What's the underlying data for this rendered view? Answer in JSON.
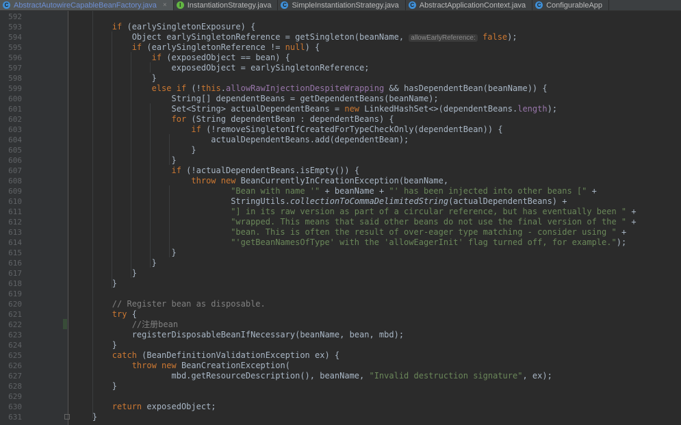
{
  "tabs": [
    {
      "label": "AbstractAutowireCapableBeanFactory.java",
      "icon": "C",
      "active": true,
      "close": "×"
    },
    {
      "label": "InstantiationStrategy.java",
      "icon": "I",
      "active": false
    },
    {
      "label": "SimpleInstantiationStrategy.java",
      "icon": "C",
      "active": false
    },
    {
      "label": "AbstractApplicationContext.java",
      "icon": "C",
      "active": false
    },
    {
      "label": "ConfigurableApp",
      "icon": "C",
      "active": false
    }
  ],
  "editor": {
    "lines": [
      {
        "n": "592",
        "segs": []
      },
      {
        "n": "593",
        "segs": [
          {
            "t": "        "
          },
          {
            "t": "if",
            "c": "kw"
          },
          {
            "t": " (earlySingletonExposure) {"
          }
        ]
      },
      {
        "n": "594",
        "segs": [
          {
            "t": "            Object earlySingletonReference = getSingleton(beanName, "
          },
          {
            "t": "allowEarlyReference:",
            "c": "hint"
          },
          {
            "t": " "
          },
          {
            "t": "false",
            "c": "kw"
          },
          {
            "t": ");"
          }
        ]
      },
      {
        "n": "595",
        "segs": [
          {
            "t": "            "
          },
          {
            "t": "if",
            "c": "kw"
          },
          {
            "t": " (earlySingletonReference != "
          },
          {
            "t": "null",
            "c": "kw"
          },
          {
            "t": ") {"
          }
        ]
      },
      {
        "n": "596",
        "segs": [
          {
            "t": "                "
          },
          {
            "t": "if",
            "c": "kw"
          },
          {
            "t": " (exposedObject == bean) {"
          }
        ]
      },
      {
        "n": "597",
        "segs": [
          {
            "t": "                    exposedObject = earlySingletonReference;"
          }
        ]
      },
      {
        "n": "598",
        "segs": [
          {
            "t": "                }"
          }
        ]
      },
      {
        "n": "599",
        "segs": [
          {
            "t": "                "
          },
          {
            "t": "else if",
            "c": "kw"
          },
          {
            "t": " (!"
          },
          {
            "t": "this",
            "c": "kw"
          },
          {
            "t": "."
          },
          {
            "t": "allowRawInjectionDespiteWrapping",
            "c": "fld"
          },
          {
            "t": " && hasDependentBean(beanName)) {"
          }
        ]
      },
      {
        "n": "600",
        "segs": [
          {
            "t": "                    String[] dependentBeans = getDependentBeans(beanName);"
          }
        ]
      },
      {
        "n": "601",
        "segs": [
          {
            "t": "                    Set<String> actualDependentBeans = "
          },
          {
            "t": "new",
            "c": "kw"
          },
          {
            "t": " LinkedHashSet<>(dependentBeans."
          },
          {
            "t": "length",
            "c": "fld"
          },
          {
            "t": ");"
          }
        ]
      },
      {
        "n": "602",
        "segs": [
          {
            "t": "                    "
          },
          {
            "t": "for",
            "c": "kw"
          },
          {
            "t": " (String dependentBean : dependentBeans) {"
          }
        ]
      },
      {
        "n": "603",
        "segs": [
          {
            "t": "                        "
          },
          {
            "t": "if",
            "c": "kw"
          },
          {
            "t": " (!removeSingletonIfCreatedForTypeCheckOnly(dependentBean)) {"
          }
        ]
      },
      {
        "n": "604",
        "segs": [
          {
            "t": "                            actualDependentBeans.add(dependentBean);"
          }
        ]
      },
      {
        "n": "605",
        "segs": [
          {
            "t": "                        }"
          }
        ]
      },
      {
        "n": "606",
        "segs": [
          {
            "t": "                    }"
          }
        ]
      },
      {
        "n": "607",
        "segs": [
          {
            "t": "                    "
          },
          {
            "t": "if",
            "c": "kw"
          },
          {
            "t": " (!actualDependentBeans.isEmpty()) {"
          }
        ]
      },
      {
        "n": "608",
        "segs": [
          {
            "t": "                        "
          },
          {
            "t": "throw new",
            "c": "kw"
          },
          {
            "t": " BeanCurrentlyInCreationException(beanName,"
          }
        ]
      },
      {
        "n": "609",
        "segs": [
          {
            "t": "                                "
          },
          {
            "t": "\"Bean with name '\"",
            "c": "str"
          },
          {
            "t": " + beanName + "
          },
          {
            "t": "\"' has been injected into other beans [\"",
            "c": "str"
          },
          {
            "t": " +"
          }
        ]
      },
      {
        "n": "610",
        "segs": [
          {
            "t": "                                StringUtils."
          },
          {
            "t": "collectionToCommaDelimitedString",
            "c": "ital"
          },
          {
            "t": "(actualDependentBeans) +"
          }
        ]
      },
      {
        "n": "611",
        "segs": [
          {
            "t": "                                "
          },
          {
            "t": "\"] in its raw version as part of a circular reference, but has eventually been \"",
            "c": "str"
          },
          {
            "t": " +"
          }
        ]
      },
      {
        "n": "612",
        "segs": [
          {
            "t": "                                "
          },
          {
            "t": "\"wrapped. This means that said other beans do not use the final version of the \"",
            "c": "str"
          },
          {
            "t": " +"
          }
        ]
      },
      {
        "n": "613",
        "segs": [
          {
            "t": "                                "
          },
          {
            "t": "\"bean. This is often the result of over-eager type matching - consider using \"",
            "c": "str"
          },
          {
            "t": " +"
          }
        ]
      },
      {
        "n": "614",
        "segs": [
          {
            "t": "                                "
          },
          {
            "t": "\"'getBeanNamesOfType' with the 'allowEagerInit' flag turned off, for example.\"",
            "c": "str"
          },
          {
            "t": ");"
          }
        ]
      },
      {
        "n": "615",
        "segs": [
          {
            "t": "                    }"
          }
        ]
      },
      {
        "n": "616",
        "segs": [
          {
            "t": "                }"
          }
        ]
      },
      {
        "n": "617",
        "segs": [
          {
            "t": "            }"
          }
        ]
      },
      {
        "n": "618",
        "segs": [
          {
            "t": "        }"
          }
        ]
      },
      {
        "n": "619",
        "segs": []
      },
      {
        "n": "620",
        "segs": [
          {
            "t": "        "
          },
          {
            "t": "// Register bean as disposable.",
            "c": "cmt"
          }
        ]
      },
      {
        "n": "621",
        "segs": [
          {
            "t": "        "
          },
          {
            "t": "try",
            "c": "kw"
          },
          {
            "t": " {"
          }
        ]
      },
      {
        "n": "622",
        "segs": [
          {
            "t": "            "
          },
          {
            "t": "//注册bean",
            "c": "cmt"
          }
        ]
      },
      {
        "n": "623",
        "segs": [
          {
            "t": "            registerDisposableBeanIfNecessary(beanName, bean, mbd);"
          }
        ]
      },
      {
        "n": "624",
        "segs": [
          {
            "t": "        }"
          }
        ]
      },
      {
        "n": "625",
        "segs": [
          {
            "t": "        "
          },
          {
            "t": "catch",
            "c": "kw"
          },
          {
            "t": " (BeanDefinitionValidationException ex) {"
          }
        ]
      },
      {
        "n": "626",
        "segs": [
          {
            "t": "            "
          },
          {
            "t": "throw new",
            "c": "kw"
          },
          {
            "t": " BeanCreationException("
          }
        ]
      },
      {
        "n": "627",
        "segs": [
          {
            "t": "                    mbd.getResourceDescription(), beanName, "
          },
          {
            "t": "\"Invalid destruction signature\"",
            "c": "str"
          },
          {
            "t": ", ex);"
          }
        ]
      },
      {
        "n": "628",
        "segs": [
          {
            "t": "        }"
          }
        ]
      },
      {
        "n": "629",
        "segs": []
      },
      {
        "n": "630",
        "segs": [
          {
            "t": "        "
          },
          {
            "t": "return",
            "c": "kw"
          },
          {
            "t": " exposedObject;"
          }
        ]
      },
      {
        "n": "631",
        "segs": [
          {
            "t": "    }"
          }
        ]
      }
    ]
  }
}
